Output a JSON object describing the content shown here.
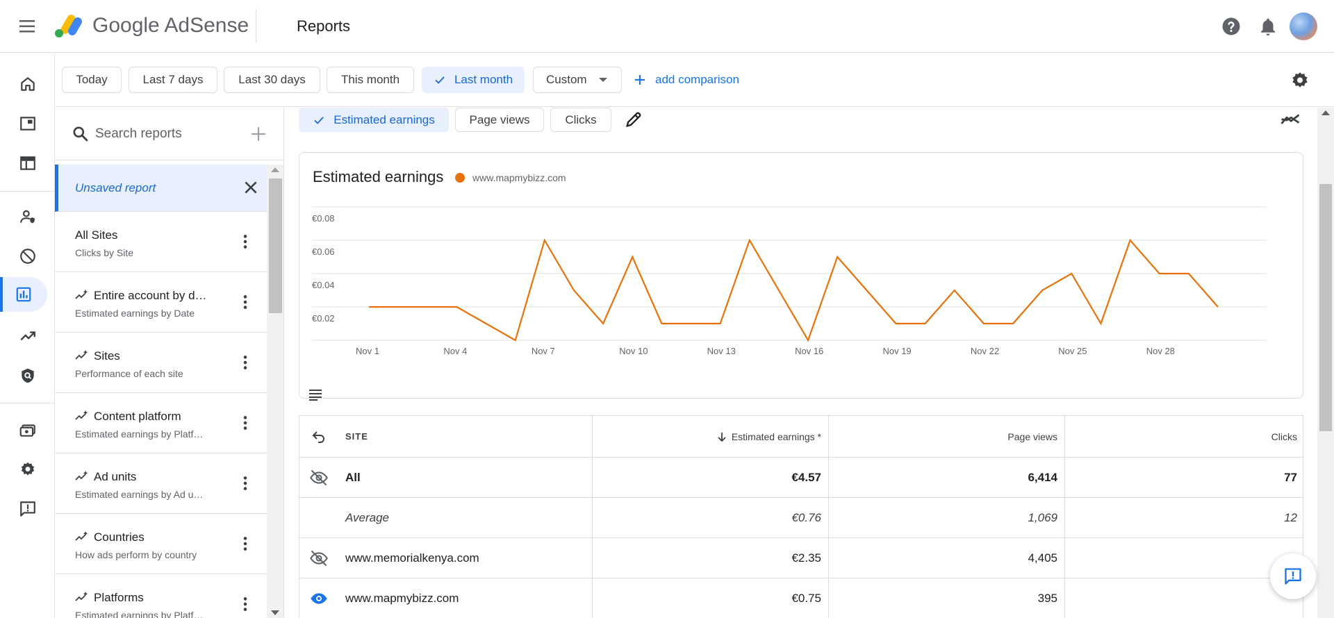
{
  "app": {
    "brand": "Google AdSense",
    "page_title": "Reports"
  },
  "rail": {
    "items": [
      {
        "name": "home-icon"
      },
      {
        "name": "ads-icon"
      },
      {
        "name": "sites-icon"
      },
      {
        "name": "privacy-messaging-icon"
      },
      {
        "name": "blocking-controls-icon"
      },
      {
        "name": "reports-icon",
        "active": true
      },
      {
        "name": "optimization-icon"
      },
      {
        "name": "policy-center-icon"
      },
      {
        "name": "payments-icon"
      },
      {
        "name": "account-settings-icon"
      },
      {
        "name": "feedback-icon"
      }
    ]
  },
  "date_filters": {
    "chips": [
      {
        "label": "Today",
        "selected": false
      },
      {
        "label": "Last 7 days",
        "selected": false
      },
      {
        "label": "Last 30 days",
        "selected": false
      },
      {
        "label": "This month",
        "selected": false
      },
      {
        "label": "Last month",
        "selected": true
      },
      {
        "label": "Custom",
        "selected": false
      }
    ],
    "add_comparison": "add comparison"
  },
  "reports_panel": {
    "search_placeholder": "Search reports",
    "unsaved_label": "Unsaved report",
    "items": [
      {
        "title": "All Sites",
        "subtitle": "Clicks by Site",
        "custom": false
      },
      {
        "title": "Entire account by d…",
        "subtitle": "Estimated earnings by Date",
        "custom": true
      },
      {
        "title": "Sites",
        "subtitle": "Performance of each site",
        "custom": true
      },
      {
        "title": "Content platform",
        "subtitle": "Estimated earnings by Platf…",
        "custom": true
      },
      {
        "title": "Ad units",
        "subtitle": "Estimated earnings by Ad u…",
        "custom": true
      },
      {
        "title": "Countries",
        "subtitle": "How ads perform by country",
        "custom": true
      },
      {
        "title": "Platforms",
        "subtitle": "Estimated earnings by Platf…",
        "custom": true
      }
    ]
  },
  "metrics": {
    "chips": [
      {
        "label": "Estimated earnings",
        "selected": true
      },
      {
        "label": "Page views",
        "selected": false
      },
      {
        "label": "Clicks",
        "selected": false
      }
    ]
  },
  "chart": {
    "title": "Estimated earnings",
    "legend": "www.mapmybizz.com",
    "color": "#e8710a"
  },
  "chart_data": {
    "type": "line",
    "title": "Estimated earnings",
    "x": [
      "Nov 1",
      "Nov 2",
      "Nov 3",
      "Nov 4",
      "Nov 5",
      "Nov 6",
      "Nov 7",
      "Nov 8",
      "Nov 9",
      "Nov 10",
      "Nov 11",
      "Nov 12",
      "Nov 13",
      "Nov 14",
      "Nov 15",
      "Nov 16",
      "Nov 17",
      "Nov 18",
      "Nov 19",
      "Nov 20",
      "Nov 21",
      "Nov 22",
      "Nov 23",
      "Nov 24",
      "Nov 25",
      "Nov 26",
      "Nov 27",
      "Nov 28",
      "Nov 29",
      "Nov 30"
    ],
    "x_ticks": [
      "Nov 1",
      "Nov 4",
      "Nov 7",
      "Nov 10",
      "Nov 13",
      "Nov 16",
      "Nov 19",
      "Nov 22",
      "Nov 25",
      "Nov 28"
    ],
    "series": [
      {
        "name": "www.mapmybizz.com",
        "values": [
          0.02,
          0.02,
          0.02,
          0.02,
          0.01,
          0.0,
          0.06,
          0.03,
          0.01,
          0.05,
          0.01,
          0.01,
          0.01,
          0.06,
          0.03,
          0.0,
          0.05,
          0.03,
          0.01,
          0.01,
          0.03,
          0.01,
          0.01,
          0.03,
          0.04,
          0.01,
          0.06,
          0.04,
          0.04,
          0.02
        ]
      }
    ],
    "y_ticks": [
      "€0.02",
      "€0.04",
      "€0.06",
      "€0.08"
    ],
    "ylim": [
      0,
      0.08
    ],
    "grid": true
  },
  "table": {
    "headers": {
      "site": "SITE",
      "earnings": "Estimated earnings *",
      "page_views": "Page views",
      "clicks": "Clicks"
    },
    "rows": [
      {
        "site": "All",
        "earnings": "€4.57",
        "page_views": "6,414",
        "clicks": "77",
        "style": "bold",
        "icon": "visibility-off-icon"
      },
      {
        "site": "Average",
        "earnings": "€0.76",
        "page_views": "1,069",
        "clicks": "12",
        "style": "italic",
        "icon": ""
      },
      {
        "site": "www.memorialkenya.com",
        "earnings": "€2.35",
        "page_views": "4,405",
        "clicks": "",
        "style": "normal",
        "icon": "visibility-off-icon"
      },
      {
        "site": "www.mapmybizz.com",
        "earnings": "€0.75",
        "page_views": "395",
        "clicks": "",
        "style": "normal",
        "icon": "visibility-icon"
      }
    ]
  }
}
